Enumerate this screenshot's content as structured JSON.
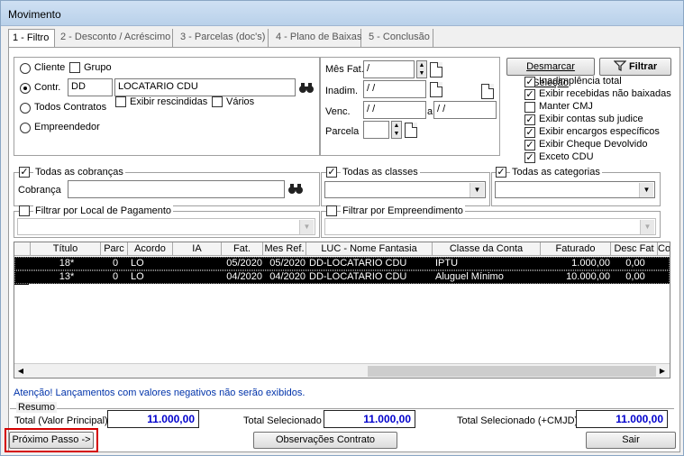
{
  "window": {
    "title": "Movimento"
  },
  "tabs": [
    {
      "label": "1 - Filtro"
    },
    {
      "label": "2 - Desconto / Acréscimo"
    },
    {
      "label": "3 - Parcelas (doc's)"
    },
    {
      "label": "4 - Plano de Baixas"
    },
    {
      "label": "5 - Conclusão"
    }
  ],
  "filter": {
    "radio_cliente": "Cliente",
    "chk_grupo": "Grupo",
    "radio_contr": "Contr.",
    "contr_code": "DD",
    "contr_name": "LOCATARIO CDU",
    "radio_todos": "Todos Contratos",
    "chk_rescindidas": "Exibir rescindidas",
    "chk_varios": "Vários",
    "radio_empreendedor": "Empreendedor",
    "mes_fat_label": "Mês Fat.",
    "mes_fat_value": "/",
    "inadim_label": "Inadim.",
    "inadim_value": "/ /",
    "venc_label": "Venc.",
    "venc_from": "/ /",
    "venc_a": "a",
    "venc_to": "/ /",
    "parcela_label": "Parcela",
    "parcela_value": ""
  },
  "actions": {
    "desmarcar": "Desmarcar Seleção",
    "filtrar": "Filtrar"
  },
  "options": [
    {
      "label": "Inadimplência total",
      "checked": true
    },
    {
      "label": "Exibir recebidas não baixadas",
      "checked": true
    },
    {
      "label": "Manter CMJ",
      "checked": false
    },
    {
      "label": "Exibir contas sub judice",
      "checked": true
    },
    {
      "label": "Exibir encargos específicos",
      "checked": true
    },
    {
      "label": "Exibir Cheque Devolvido",
      "checked": true
    },
    {
      "label": "Exceto CDU",
      "checked": true
    }
  ],
  "cobrancas": {
    "title": "Todas as cobranças",
    "cobranca_label": "Cobrança",
    "value": ""
  },
  "classes": {
    "title": "Todas as classes",
    "value": ""
  },
  "categorias": {
    "title": "Todas as categorias",
    "value": ""
  },
  "local_pagamento": {
    "title": "Filtrar por Local de Pagamento",
    "value": ""
  },
  "empreendimento": {
    "title": "Filtrar por Empreendimento",
    "value": ""
  },
  "grid": {
    "columns": [
      "Título",
      "Parc",
      "Acordo",
      "IA",
      "Fat.",
      "Mes Ref.",
      "LUC - Nome Fantasia",
      "Classe da Conta",
      "Faturado",
      "Desc Fat",
      "Co"
    ],
    "rows": [
      {
        "titulo": "18*",
        "parc": "0",
        "acordo": "LO",
        "ia": "",
        "fat": "05/2020",
        "mesref": "05/2020",
        "luc": "DD-LOCATARIO CDU",
        "classe": "IPTU",
        "faturado": "1.000,00",
        "desc": "0,00"
      },
      {
        "titulo": "13*",
        "parc": "0",
        "acordo": "LO",
        "ia": "",
        "fat": "04/2020",
        "mesref": "04/2020",
        "luc": "DD-LOCATARIO CDU",
        "classe": "Aluguel Mínimo",
        "faturado": "10.000,00",
        "desc": "0,00"
      }
    ]
  },
  "warning": "Atenção! Lançamentos com valores negativos não serão exibidos.",
  "resumo": {
    "title": "Resumo",
    "total_label": "Total (Valor Principal)",
    "total_value": "11.000,00",
    "selecionado_label": "Total Selecionado",
    "selecionado_value": "11.000,00",
    "selecionado_cmjd_label": "Total Selecionado (+CMJD)",
    "selecionado_cmjd_value": "11.000,00"
  },
  "footer": {
    "proximo": "Próximo Passo ->",
    "observacoes": "Observações Contrato",
    "sair": "Sair"
  },
  "colors": {
    "highlight": "#d40000",
    "total_text": "#0000cc",
    "warning_text": "#0033aa"
  }
}
